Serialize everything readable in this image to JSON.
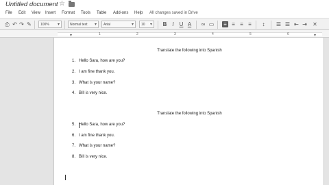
{
  "window": {
    "doc_title": "Untitled document",
    "star_icon": "star-icon",
    "folder_icon": "folder-icon"
  },
  "menu": {
    "items": [
      "File",
      "Edit",
      "View",
      "Insert",
      "Format",
      "Tools",
      "Table",
      "Add-ons",
      "Help"
    ],
    "save_status": "All changes saved in Drive"
  },
  "toolbar": {
    "zoom": "100%",
    "style": "Normal text",
    "font": "Arial",
    "font_size": "10",
    "icons": [
      "print-icon",
      "undo-icon",
      "redo-icon",
      "paint-format-icon",
      "bold-icon",
      "italic-icon",
      "underline-icon",
      "text-color-icon",
      "link-icon",
      "comment-icon",
      "align-left-icon",
      "align-center-icon",
      "align-right-icon",
      "justify-icon",
      "line-spacing-icon",
      "numbered-list-icon",
      "bulleted-list-icon",
      "decrease-indent-icon",
      "increase-indent-icon",
      "clear-format-icon"
    ]
  },
  "ruler": {
    "numbers": [
      "1",
      "2",
      "3",
      "4",
      "5",
      "6"
    ]
  },
  "document": {
    "section1": {
      "heading": "Translate the following into Spanish",
      "items": [
        {
          "num": "1.",
          "text": "Hello Sara, how are you?"
        },
        {
          "num": "2.",
          "text": "I am fine thank you."
        },
        {
          "num": "3.",
          "text": "What is your name?"
        },
        {
          "num": "4.",
          "text": "Bill is very nice."
        }
      ]
    },
    "section2": {
      "heading": "Translate the following into Spanish",
      "items": [
        {
          "num": "5.",
          "text": "Hello Sara, how are you?"
        },
        {
          "num": "6.",
          "text": "I am fine thank you."
        },
        {
          "num": "7.",
          "text": "What is your name?"
        },
        {
          "num": "8.",
          "text": "Bill is very nice."
        }
      ]
    }
  }
}
